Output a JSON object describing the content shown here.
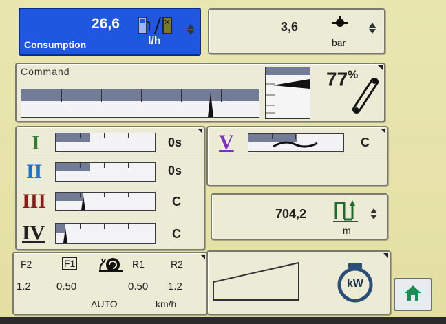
{
  "consumption": {
    "value": "26,6",
    "unit": "l/h",
    "label": "Consumption"
  },
  "pressure": {
    "value": "3,6",
    "unit": "bar"
  },
  "command": {
    "label": "Command",
    "percent": "77",
    "percent_sign": "%",
    "level": 0.77
  },
  "channels": [
    {
      "numeral": "I",
      "status": "0s",
      "level": 0.15,
      "color": "#2e7d32"
    },
    {
      "numeral": "II",
      "status": "0s",
      "level": 0.3,
      "color": "#1976d2"
    },
    {
      "numeral": "III",
      "status": "C",
      "level": 0.28,
      "color": "#8b1a1a"
    },
    {
      "numeral": "IV",
      "status": "C",
      "level": 0.12,
      "color": "#222222"
    },
    {
      "numeral": "V",
      "status": "C",
      "level": 0.5,
      "color": "#7b2fbf"
    }
  ],
  "depth": {
    "value": "704,2",
    "unit": "m"
  },
  "transmission": {
    "labels": [
      "F2",
      "F1",
      "R1",
      "R2"
    ],
    "values": [
      "1.2",
      "0.50",
      "0.50",
      "1.2"
    ],
    "mode": "AUTO",
    "speed_unit": "km/h"
  },
  "engine": {
    "label": "kW"
  }
}
